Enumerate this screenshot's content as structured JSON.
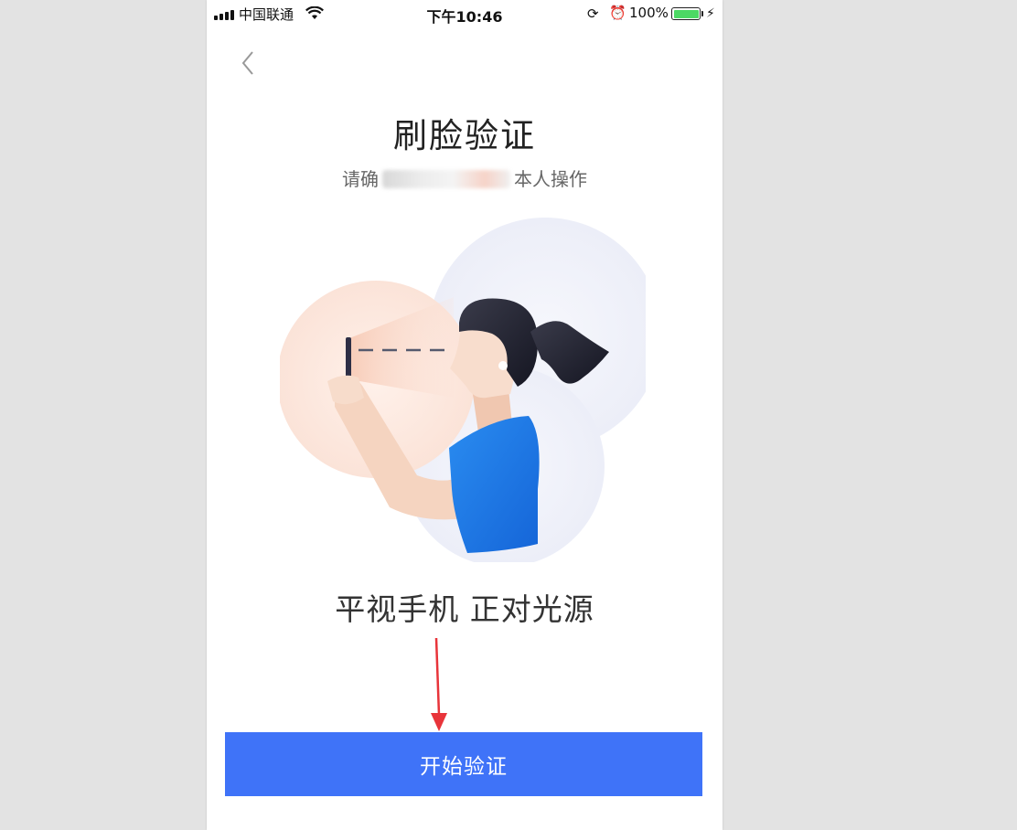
{
  "status_bar": {
    "carrier": "中国联通",
    "time": "下午10:46",
    "battery_percent": "100%",
    "icons": [
      "signal-icon",
      "wifi-icon",
      "rotation-lock-icon",
      "alarm-icon",
      "battery-icon",
      "charging-icon"
    ]
  },
  "header": {
    "back_icon": "chevron-left-icon",
    "title": "刷脸验证",
    "subtitle_prefix": "请确",
    "subtitle_suffix": "本人操作"
  },
  "illustration": {
    "description_icon": "face-scan-illustration"
  },
  "instruction": "平视手机 正对光源",
  "primary_button": {
    "label": "开始验证",
    "color": "#3f73f8"
  },
  "annotation": {
    "arrow_color": "#e8343a"
  }
}
